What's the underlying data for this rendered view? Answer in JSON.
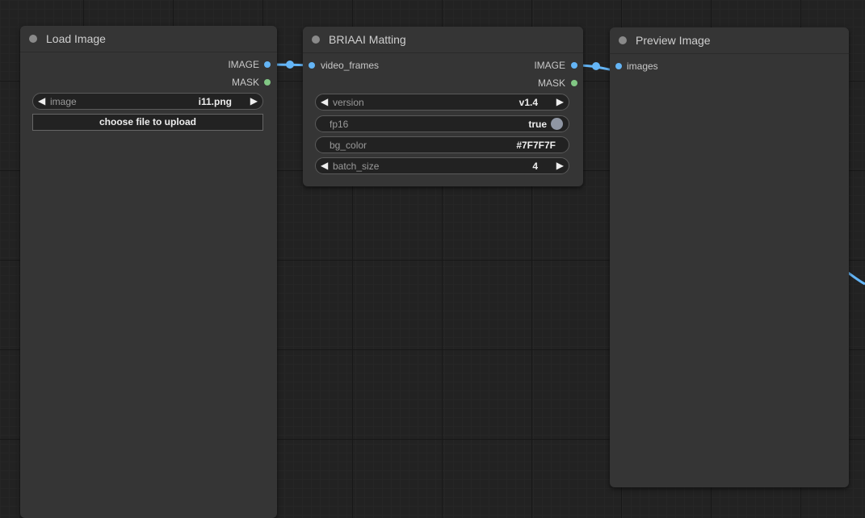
{
  "nodes": {
    "load_image": {
      "title": "Load Image",
      "outputs": [
        "IMAGE",
        "MASK"
      ],
      "image_widget": {
        "label": "image",
        "value": "i11.png"
      },
      "upload_button": "choose file to upload"
    },
    "briaai_matting": {
      "title": "BRIAAI Matting",
      "input": "video_frames",
      "outputs": [
        "IMAGE",
        "MASK"
      ],
      "widgets": {
        "version": {
          "label": "version",
          "value": "v1.4"
        },
        "fp16": {
          "label": "fp16",
          "value": "true"
        },
        "bg_color": {
          "label": "bg_color",
          "value": "#7F7F7F"
        },
        "batch_size": {
          "label": "batch_size",
          "value": "4"
        }
      }
    },
    "preview_image": {
      "title": "Preview Image",
      "input": "images"
    }
  },
  "colors": {
    "image_slot": "#64b5f6",
    "mask_slot": "#81c784",
    "link": "#64b5f6"
  },
  "icons": {
    "decrement": "left-triangle-icon",
    "increment": "right-triangle-icon",
    "toggle": "toggle-knob-icon"
  }
}
